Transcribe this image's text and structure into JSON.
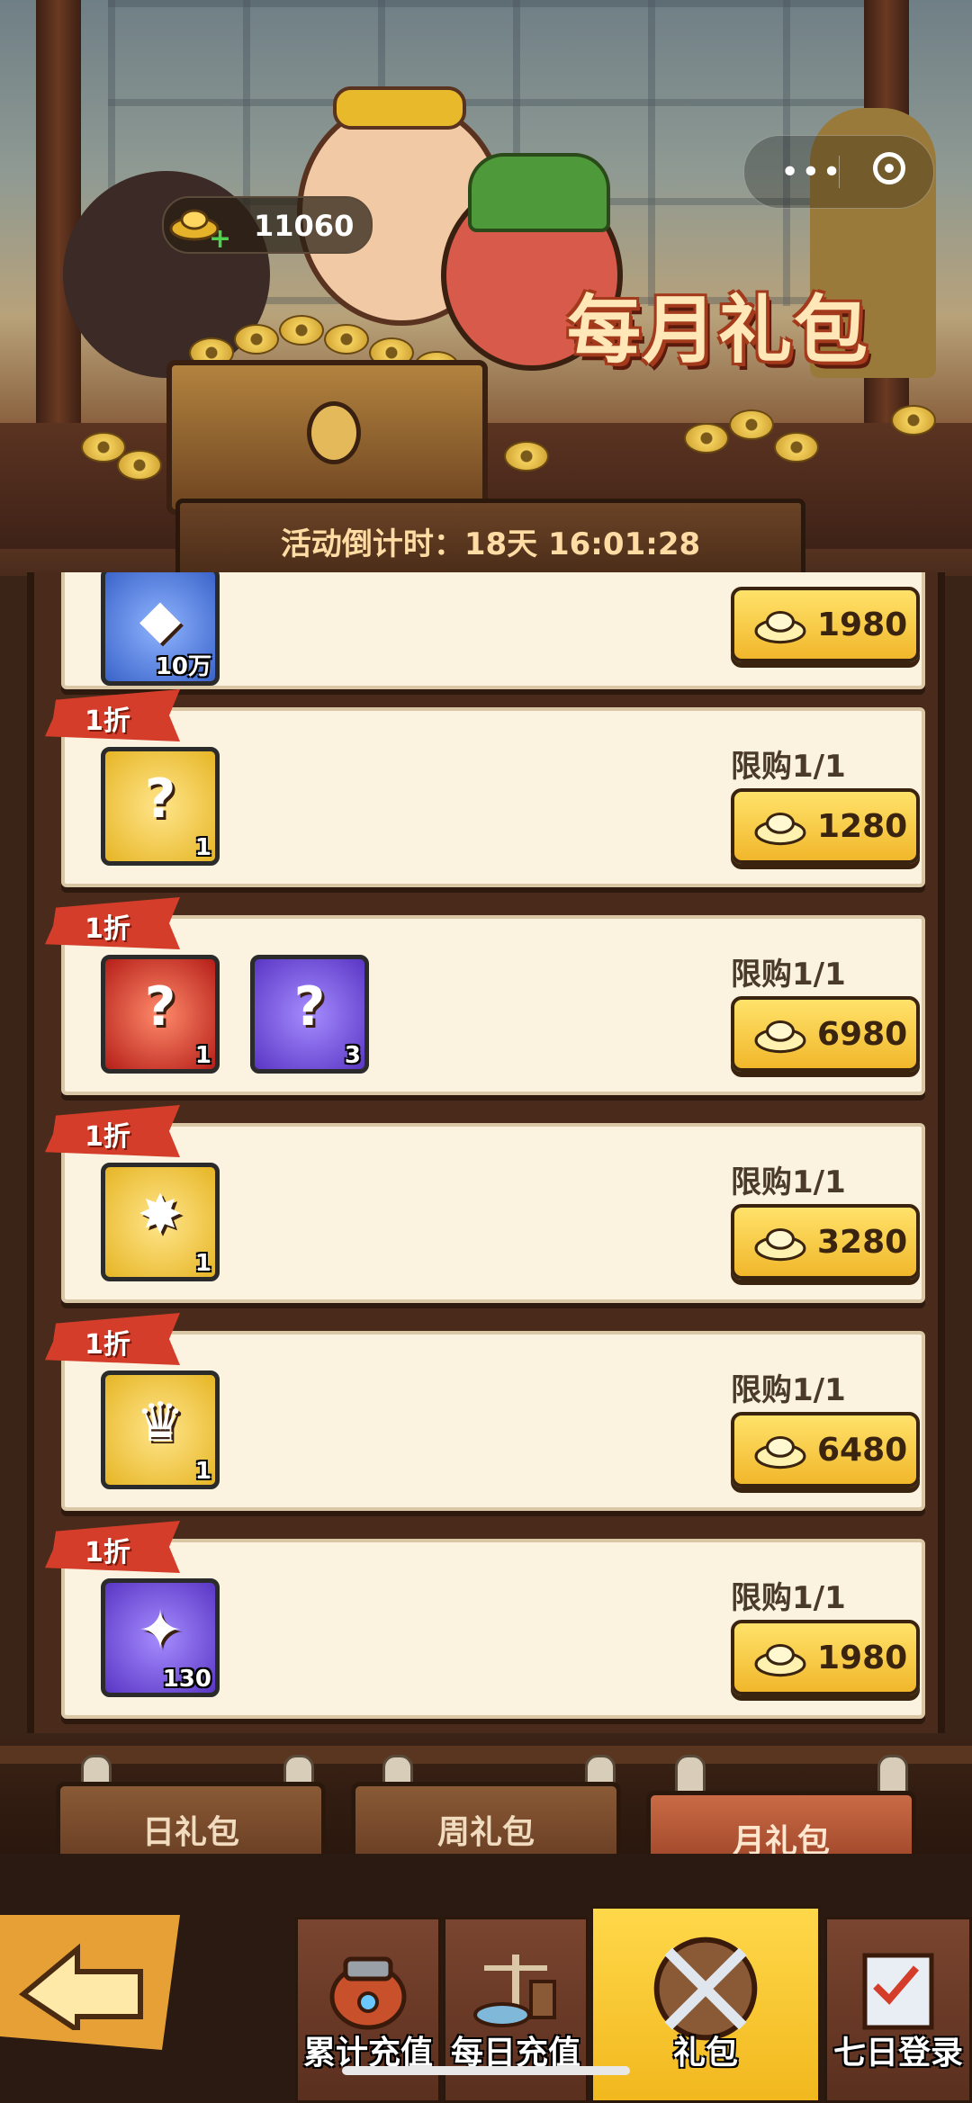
{
  "header": {
    "title": "每月礼包",
    "currency_value": "11060",
    "countdown": "活动倒计时：18天 16:01:28"
  },
  "packs": [
    {
      "discount": "",
      "limit": "",
      "price": "1980",
      "items": [
        {
          "type": "blue",
          "icon": "token-icon",
          "glyph": "◆",
          "qty": "10万"
        }
      ]
    },
    {
      "discount": "1折",
      "limit": "限购1/1",
      "price": "1280",
      "items": [
        {
          "type": "gold",
          "icon": "mystery-bag-icon",
          "glyph": "?",
          "qty": "1"
        }
      ]
    },
    {
      "discount": "1折",
      "limit": "限购1/1",
      "price": "6980",
      "items": [
        {
          "type": "red",
          "icon": "mystery-bag-icon",
          "glyph": "?",
          "qty": "1"
        },
        {
          "type": "purple",
          "icon": "mystery-bag-icon",
          "glyph": "?",
          "qty": "3"
        }
      ]
    },
    {
      "discount": "1折",
      "limit": "限购1/1",
      "price": "3280",
      "items": [
        {
          "type": "gold",
          "icon": "chest-icon",
          "glyph": "✸",
          "qty": "1"
        }
      ]
    },
    {
      "discount": "1折",
      "limit": "限购1/1",
      "price": "6480",
      "items": [
        {
          "type": "gold",
          "icon": "chest-icon",
          "glyph": "♛",
          "qty": "1"
        }
      ]
    },
    {
      "discount": "1折",
      "limit": "限购1/1",
      "price": "1980",
      "items": [
        {
          "type": "purple",
          "icon": "phoenix-icon",
          "glyph": "✦",
          "qty": "130"
        }
      ]
    }
  ],
  "tabs": {
    "daily": "日礼包",
    "weekly": "周礼包",
    "monthly": "月礼包"
  },
  "nav": {
    "cumulative": "累计充值",
    "daily_recharge": "每日充值",
    "gift": "礼包",
    "seven_day": "七日登录"
  }
}
